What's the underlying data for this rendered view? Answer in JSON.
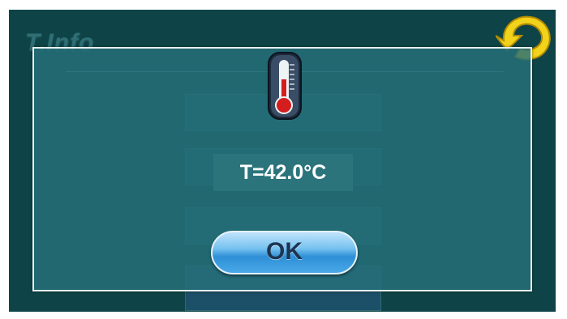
{
  "background": {
    "title": "T.Info",
    "menu_items": [
      "",
      "",
      "",
      ""
    ]
  },
  "dialog": {
    "icon": "thermometer-icon",
    "temperature_text": "T=42.0°C",
    "ok_label": "OK"
  },
  "colors": {
    "screen_background": "#0e4447",
    "dialog_background": "#26707a",
    "dialog_border": "#e6eff0",
    "ok_button": "#4aa9e8",
    "back_icon": "#f2d21a"
  }
}
